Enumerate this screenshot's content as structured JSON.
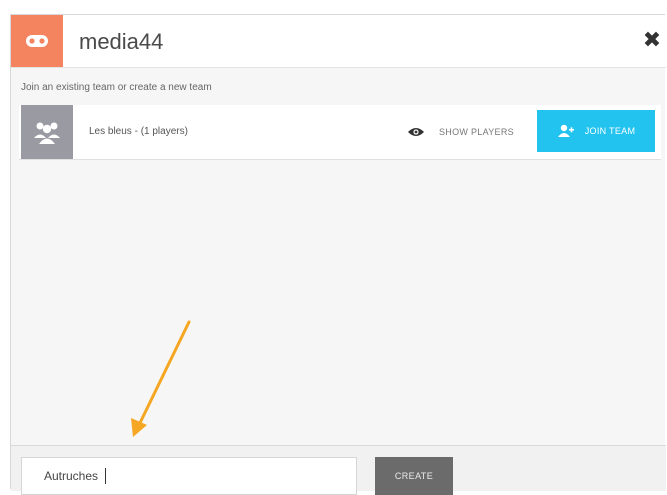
{
  "header": {
    "title": "media44",
    "close_icon": "close-icon"
  },
  "instruction": "Join an existing team or create a new team",
  "teams": [
    {
      "name": "Les bleus - (1 players)",
      "show_players_label": "SHOW PLAYERS",
      "join_label": "JOIN TEAM"
    }
  ],
  "footer": {
    "team_name_value": "Autruches",
    "create_label": "CREATE"
  },
  "colors": {
    "brand": "#f4845f",
    "join_button": "#22c3ef",
    "create_button": "#6b6b6b",
    "arrow": "#f5a623"
  }
}
